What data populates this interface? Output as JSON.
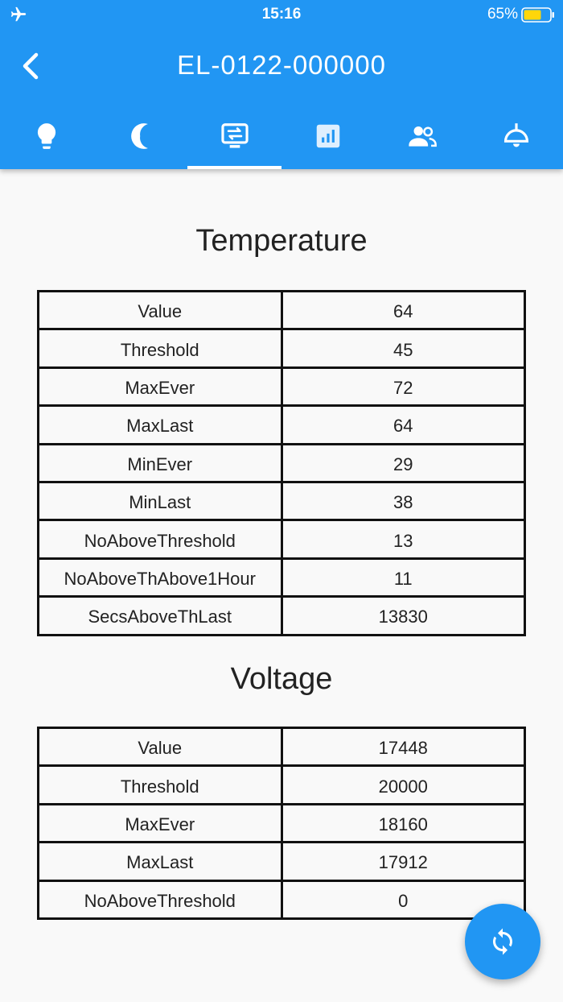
{
  "status_bar": {
    "time": "15:16",
    "battery": "65%"
  },
  "header": {
    "title": "EL-0122-000000"
  },
  "tabs": [
    {
      "icon": "lightbulb-icon"
    },
    {
      "icon": "moon-icon"
    },
    {
      "icon": "device-settings-icon",
      "active": true
    },
    {
      "icon": "bar-chart-icon"
    },
    {
      "icon": "people-icon"
    },
    {
      "icon": "ceiling-lamp-icon"
    }
  ],
  "temperature": {
    "title": "Temperature",
    "rows": [
      {
        "label": "Value",
        "value": "64"
      },
      {
        "label": "Threshold",
        "value": "45"
      },
      {
        "label": "MaxEver",
        "value": "72"
      },
      {
        "label": "MaxLast",
        "value": "64"
      },
      {
        "label": "MinEver",
        "value": "29"
      },
      {
        "label": "MinLast",
        "value": "38"
      },
      {
        "label": "NoAboveThreshold",
        "value": "13"
      },
      {
        "label": "NoAboveThAbove1Hour",
        "value": "11"
      },
      {
        "label": "SecsAboveThLast",
        "value": "13830"
      }
    ]
  },
  "voltage": {
    "title": "Voltage",
    "rows": [
      {
        "label": "Value",
        "value": "17448"
      },
      {
        "label": "Threshold",
        "value": "20000"
      },
      {
        "label": "MaxEver",
        "value": "18160"
      },
      {
        "label": "MaxLast",
        "value": "17912"
      },
      {
        "label": "NoAboveThreshold",
        "value": "0"
      }
    ]
  },
  "fab": {
    "icon": "refresh-icon"
  },
  "colors": {
    "primary": "#2196f3",
    "background": "#f9f9f9",
    "battery_fill": "#ffd60a"
  }
}
